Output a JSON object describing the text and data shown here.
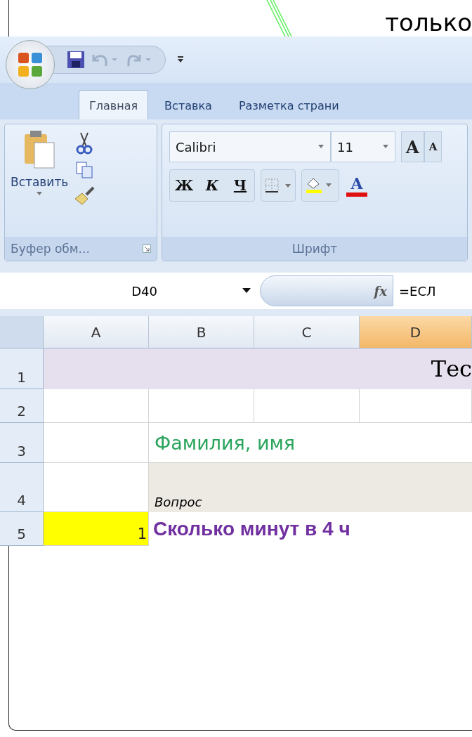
{
  "slide": {
    "heading": "только"
  },
  "excel": {
    "tabs": [
      {
        "label": "Главная",
        "selected": true
      },
      {
        "label": "Вставка",
        "selected": false
      },
      {
        "label": "Разметка страни",
        "selected": false
      }
    ],
    "clipboard": {
      "paste_label": "Вставить",
      "group_label": "Буфер обм..."
    },
    "font": {
      "name": "Calibri",
      "size": "11",
      "grow_label": "A",
      "shrink_label": "A",
      "bold_label": "Ж",
      "italic_label": "К",
      "underline_label": "Ч",
      "color_label": "A",
      "group_label": "Шрифт"
    },
    "name_box": "D40",
    "function_label": "fx",
    "formula": "=ЕСЛ",
    "columns": [
      {
        "label": "A",
        "selected": false
      },
      {
        "label": "B",
        "selected": false
      },
      {
        "label": "C",
        "selected": false
      },
      {
        "label": "D",
        "selected": true
      }
    ],
    "rows": [
      {
        "number": "1",
        "kind": "title",
        "text": "Тес"
      },
      {
        "number": "2",
        "kind": "blank"
      },
      {
        "number": "3",
        "kind": "name",
        "text": "Фамилия, имя"
      },
      {
        "number": "4",
        "kind": "header",
        "text": "Вопрос"
      },
      {
        "number": "5",
        "kind": "question",
        "index": "1",
        "text": "Сколько минут в 4 ч"
      }
    ]
  }
}
